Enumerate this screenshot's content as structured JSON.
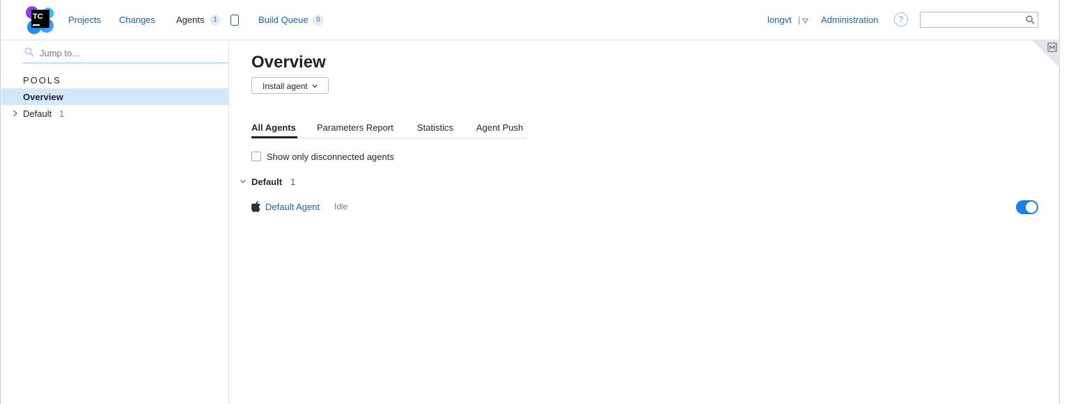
{
  "header": {
    "logo_text": "TC",
    "nav": {
      "projects": "Projects",
      "changes": "Changes",
      "agents": "Agents",
      "agents_count": "1",
      "build_queue": "Build Queue",
      "build_queue_count": "0"
    },
    "user": {
      "name": "longvt",
      "separator": "|"
    },
    "administration": "Administration",
    "help_glyph": "?",
    "search": {
      "value": "",
      "placeholder": ""
    }
  },
  "sidebar": {
    "jump_placeholder": "Jump to...",
    "pools_heading": "POOLS",
    "items": [
      {
        "label": "Overview",
        "selected": true
      },
      {
        "label": "Default",
        "count": "1",
        "selected": false
      }
    ]
  },
  "main": {
    "title": "Overview",
    "install_agent_label": "Install agent",
    "tabs": [
      {
        "label": "All Agents",
        "active": true
      },
      {
        "label": "Parameters Report",
        "active": false
      },
      {
        "label": "Statistics",
        "active": false
      },
      {
        "label": "Agent Push",
        "active": false
      }
    ],
    "show_disconnected_label": "Show only disconnected agents",
    "show_disconnected_checked": false,
    "group": {
      "name": "Default",
      "count": "1",
      "agents": [
        {
          "name": "Default Agent",
          "status": "Idle",
          "os_icon": "apple-icon",
          "enabled": true
        }
      ]
    }
  },
  "colors": {
    "link": "#1b63b4",
    "selected_bg": "#d4e8fb",
    "toggle_on": "#1a7fe8",
    "badge_bg": "#e4edf7"
  }
}
